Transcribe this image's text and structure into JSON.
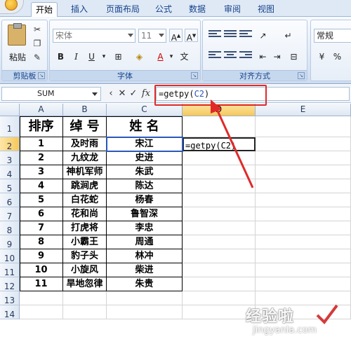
{
  "ribbon_tabs": [
    "开始",
    "插入",
    "页面布局",
    "公式",
    "数据",
    "审阅",
    "视图"
  ],
  "ribbon": {
    "clipboard": {
      "paste_label": "粘贴",
      "group_label": "剪贴板"
    },
    "font": {
      "font_name": "宋体",
      "font_size": "11",
      "group_label": "字体"
    },
    "alignment": {
      "group_label": "对齐方式"
    },
    "number": {
      "format": "常规"
    }
  },
  "formula_bar": {
    "name_box": "SUM",
    "formula_prefix": "=getpy(",
    "formula_ref": "C2",
    "formula_suffix": ")"
  },
  "columns": [
    "A",
    "B",
    "C",
    "D",
    "E"
  ],
  "rows": [
    "1",
    "2",
    "3",
    "4",
    "5",
    "6",
    "7",
    "8",
    "9",
    "10",
    "11",
    "12",
    "13",
    "14"
  ],
  "table": {
    "headers": [
      "排序",
      "绰 号",
      "姓 名"
    ],
    "data": [
      [
        "1",
        "及时雨",
        "宋江"
      ],
      [
        "2",
        "九纹龙",
        "史进"
      ],
      [
        "3",
        "神机军师",
        "朱武"
      ],
      [
        "4",
        "跳涧虎",
        "陈达"
      ],
      [
        "5",
        "白花蛇",
        "杨春"
      ],
      [
        "6",
        "花和尚",
        "鲁智深"
      ],
      [
        "7",
        "打虎将",
        "李忠"
      ],
      [
        "8",
        "小霸王",
        "周通"
      ],
      [
        "9",
        "豹子头",
        "林冲"
      ],
      [
        "10",
        "小旋风",
        "柴进"
      ],
      [
        "11",
        "旱地忽律",
        "朱贵"
      ]
    ]
  },
  "editing_cell": {
    "text": "=getpy(C2)"
  },
  "watermark": {
    "text": "经验啦",
    "url": "jingyanla.com"
  },
  "colors": {
    "highlight": "#e02a2a",
    "ref_blue": "#2a57b8",
    "selected_header": "#f6c85a"
  }
}
